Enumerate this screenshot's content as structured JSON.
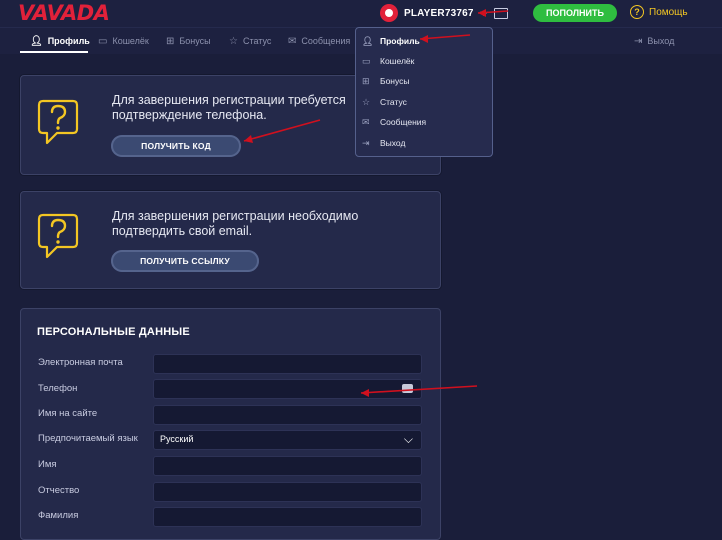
{
  "header": {
    "logo": "VAVADA",
    "username": "PLAYER73767",
    "deposit_label": "ПОПОЛНИТЬ",
    "help_label": "Помощь",
    "help_icon_glyph": "?"
  },
  "nav": {
    "items": [
      {
        "label": "Профиль",
        "icon": "user-icon"
      },
      {
        "label": "Кошелёк",
        "icon": "wallet-icon"
      },
      {
        "label": "Бонусы",
        "icon": "gift-icon"
      },
      {
        "label": "Статус",
        "icon": "star-icon"
      },
      {
        "label": "Сообщения",
        "icon": "mail-icon"
      }
    ],
    "logout_label": "Выход",
    "active": "Профиль"
  },
  "phone_card": {
    "text": "Для завершения регистрации требуется подтверждение телефона.",
    "button": "ПОЛУЧИТЬ КОД"
  },
  "email_card": {
    "text": "Для завершения регистрации необходимо подтвердить свой email.",
    "button": "ПОЛУЧИТЬ ССЫЛКУ"
  },
  "personal": {
    "title": "ПЕРСОНАЛЬНЫЕ ДАННЫЕ",
    "fields": [
      {
        "label": "Электронная почта",
        "value": ""
      },
      {
        "label": "Телефон",
        "value": ""
      },
      {
        "label": "Имя на сайте",
        "value": ""
      },
      {
        "label": "Предпочитаемый язык",
        "value": "Русский"
      },
      {
        "label": "Имя",
        "value": ""
      },
      {
        "label": "Отчество",
        "value": ""
      },
      {
        "label": "Фамилия",
        "value": ""
      }
    ]
  },
  "dropdown": {
    "items": [
      {
        "label": "Профиль",
        "icon": "user-icon"
      },
      {
        "label": "Кошелёк",
        "icon": "wallet-icon"
      },
      {
        "label": "Бонусы",
        "icon": "gift-icon"
      },
      {
        "label": "Статус",
        "icon": "star-icon"
      },
      {
        "label": "Сообщения",
        "icon": "mail-icon"
      },
      {
        "label": "Выход",
        "icon": "logout-icon"
      }
    ]
  },
  "colors": {
    "brand_red": "#e2213a",
    "deposit_green": "#2fbd40",
    "help_yellow": "#f3c623",
    "annotation_arrow": "#d0101e"
  }
}
